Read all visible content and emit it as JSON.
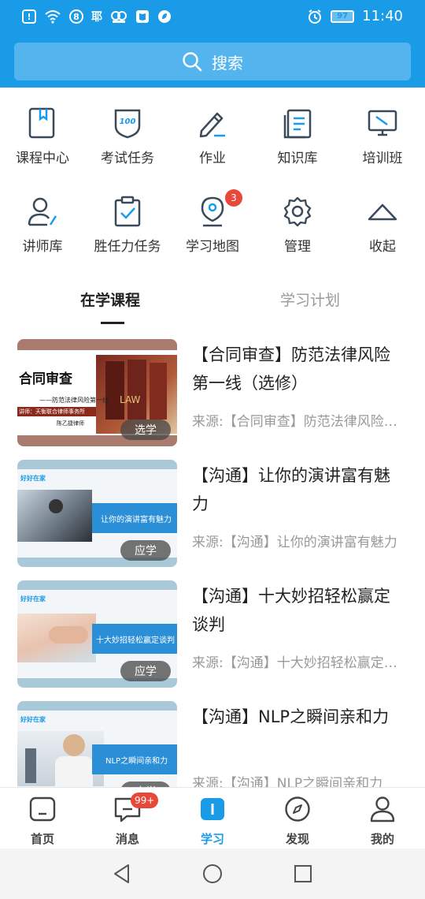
{
  "status_bar": {
    "left_icons": [
      "alert-icon",
      "wifi-icon",
      "hd-icon",
      "job-app-icon",
      "app-icon",
      "book-app-icon",
      "leaf-app-icon"
    ],
    "battery": "97",
    "time": "11:40"
  },
  "search": {
    "placeholder": "搜索"
  },
  "grid": [
    {
      "label": "课程中心",
      "icon": "book-icon"
    },
    {
      "label": "考试任务",
      "icon": "score-shield-icon"
    },
    {
      "label": "作业",
      "icon": "pencil-icon"
    },
    {
      "label": "知识库",
      "icon": "document-icon"
    },
    {
      "label": "培训班",
      "icon": "screen-icon"
    },
    {
      "label": "讲师库",
      "icon": "teacher-icon"
    },
    {
      "label": "胜任力任务",
      "icon": "clipboard-check-icon"
    },
    {
      "label": "学习地图",
      "icon": "map-pin-icon",
      "badge": "3"
    },
    {
      "label": "管理",
      "icon": "gear-icon"
    },
    {
      "label": "收起",
      "icon": "chevron-up-icon"
    }
  ],
  "tabs": {
    "active": "在学课程",
    "inactive": "学习计划"
  },
  "courses": [
    {
      "title": "【合同审查】防范法律风险第一线（选修）",
      "source": "来源:【合同审查】防范法律风险第一线（选修）",
      "tag": "选学",
      "thumb": {
        "heading": "合同审查",
        "sub": "——防范法律风险第一线",
        "lecturer": "讲师：天衡联合律师事务所",
        "lecturer2": "陈乙捷律师",
        "brand": "LAW"
      }
    },
    {
      "title": "【沟通】让你的演讲富有魅力",
      "source": "来源:【沟通】让你的演讲富有魅力",
      "tag": "应学",
      "thumb": {
        "logo": "好好在家",
        "caption": "让你的演讲富有魅力"
      }
    },
    {
      "title": "【沟通】十大妙招轻松赢定谈判",
      "source": "来源:【沟通】十大妙招轻松赢定谈判",
      "tag": "应学",
      "thumb": {
        "logo": "好好在家",
        "caption": "十大妙招轻松赢定谈判"
      }
    },
    {
      "title": "【沟通】NLP之瞬间亲和力",
      "source": "来源:【沟通】NLP之瞬间亲和力",
      "tag": "应学",
      "thumb": {
        "logo": "好好在家",
        "caption": "NLP之瞬间亲和力"
      }
    }
  ],
  "bottom_nav": [
    {
      "label": "首页",
      "icon": "home-icon"
    },
    {
      "label": "消息",
      "icon": "message-icon",
      "badge": "99+"
    },
    {
      "label": "学习",
      "icon": "study-icon",
      "active": true
    },
    {
      "label": "发现",
      "icon": "compass-icon"
    },
    {
      "label": "我的",
      "icon": "user-icon"
    }
  ],
  "colors": {
    "primary": "#1a9be8",
    "badge": "#e8483a",
    "icon_stroke": "#3a4a5a",
    "icon_accent": "#1a9be8"
  }
}
